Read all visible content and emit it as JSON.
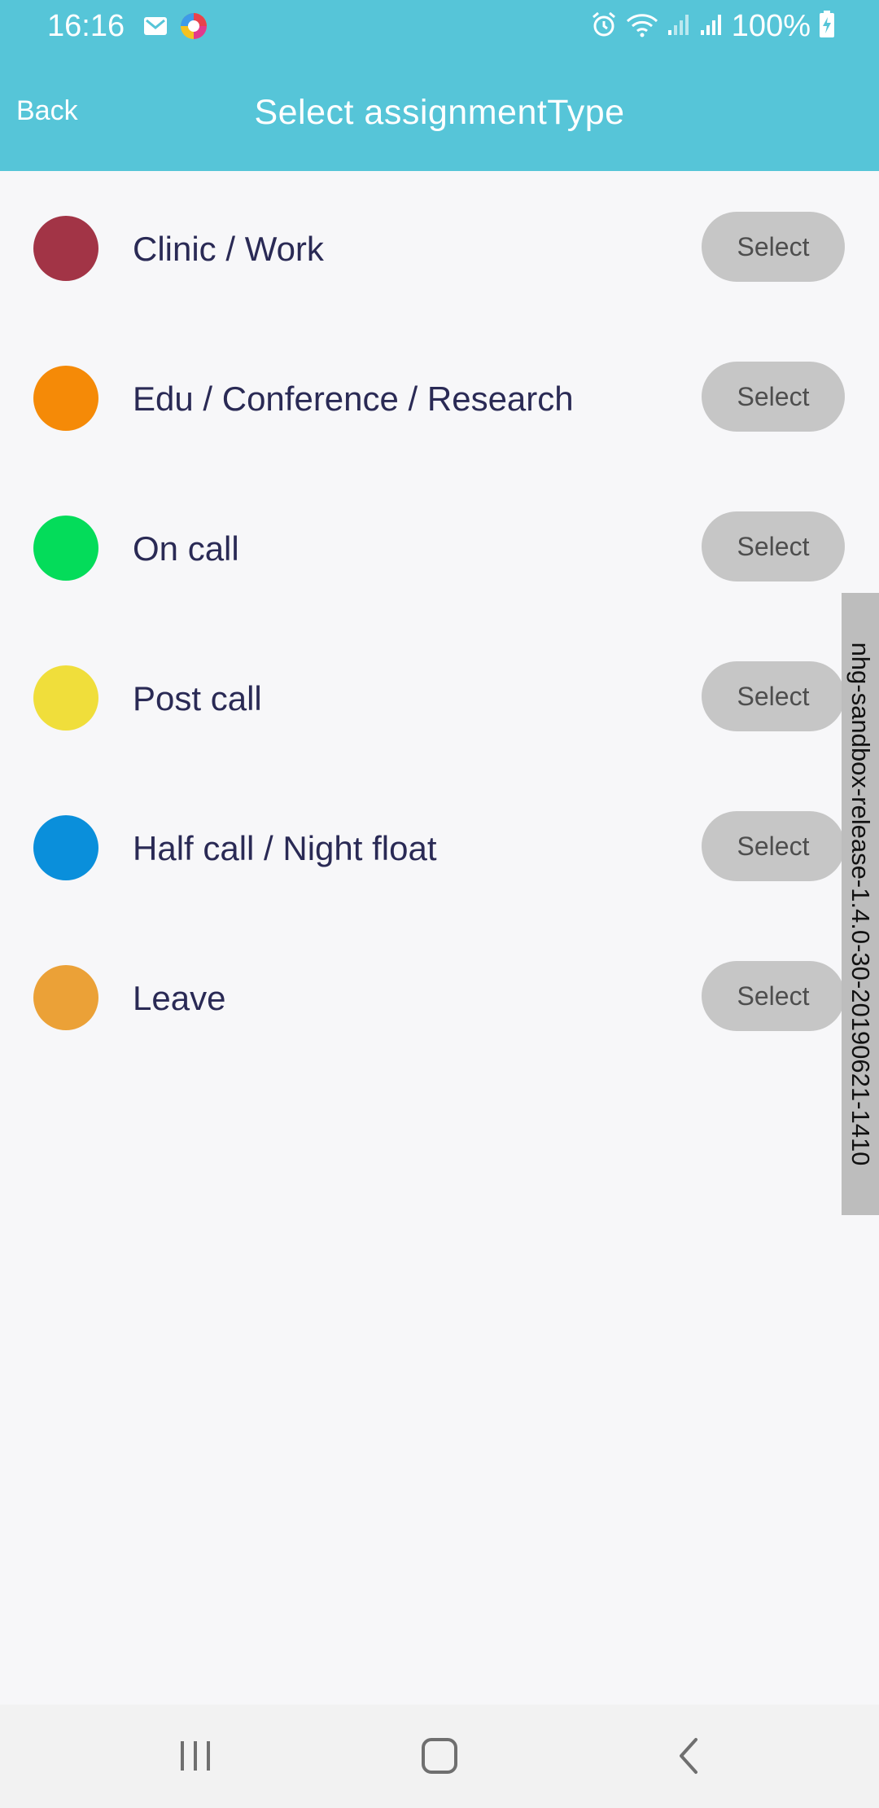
{
  "status_bar": {
    "time": "16:16",
    "left_icons": [
      "gmail-icon",
      "app-notification-icon"
    ],
    "right_icons": [
      "alarm-icon",
      "wifi-icon",
      "signal-icon",
      "signal-icon-2",
      "battery-charging-icon"
    ],
    "battery": "100%"
  },
  "header": {
    "back_label": "Back",
    "title": "Select assignmentType"
  },
  "assignment_types": [
    {
      "label": "Clinic / Work",
      "color": "#A23446",
      "select_label": "Select"
    },
    {
      "label": "Edu / Conference / Research",
      "color": "#F58A07",
      "select_label": "Select"
    },
    {
      "label": "On call",
      "color": "#04DC5A",
      "select_label": "Select"
    },
    {
      "label": "Post call",
      "color": "#F0DE3B",
      "select_label": "Select"
    },
    {
      "label": "Half call / Night float",
      "color": "#0A8FDB",
      "select_label": "Select"
    },
    {
      "label": "Leave",
      "color": "#EBA137",
      "select_label": "Select"
    }
  ],
  "watermark": "nhg-sandbox-release-1.4.0-30-20190621-1410",
  "colors": {
    "header_bg": "#56C5D8",
    "background": "#F7F7F9",
    "button_bg": "#C6C6C6",
    "label_text": "#2A2A55"
  },
  "nav_bar": {
    "icons": [
      "recent-apps-icon",
      "home-icon",
      "back-icon"
    ]
  }
}
